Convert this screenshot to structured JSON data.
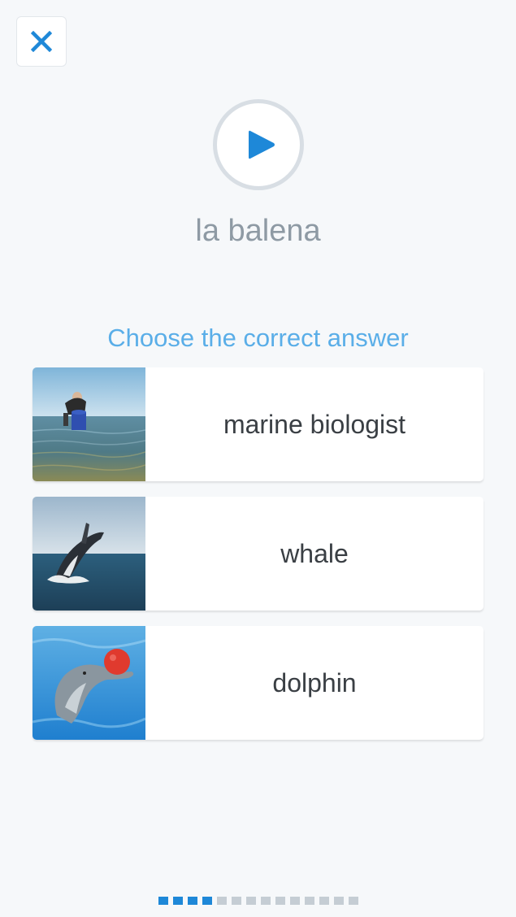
{
  "header": {
    "close_icon": "close-icon"
  },
  "audio": {
    "play_icon": "play-icon"
  },
  "word": "la balena",
  "prompt": "Choose the correct answer",
  "options": [
    {
      "label": "marine biologist",
      "image": "person-in-water"
    },
    {
      "label": "whale",
      "image": "breaching-whale"
    },
    {
      "label": "dolphin",
      "image": "dolphin-with-ball"
    }
  ],
  "progress": {
    "total": 14,
    "completed": 4
  },
  "colors": {
    "accent": "#1e88d8",
    "prompt": "#5aaee8",
    "word": "#8e9aa4",
    "background": "#f6f8fa"
  }
}
